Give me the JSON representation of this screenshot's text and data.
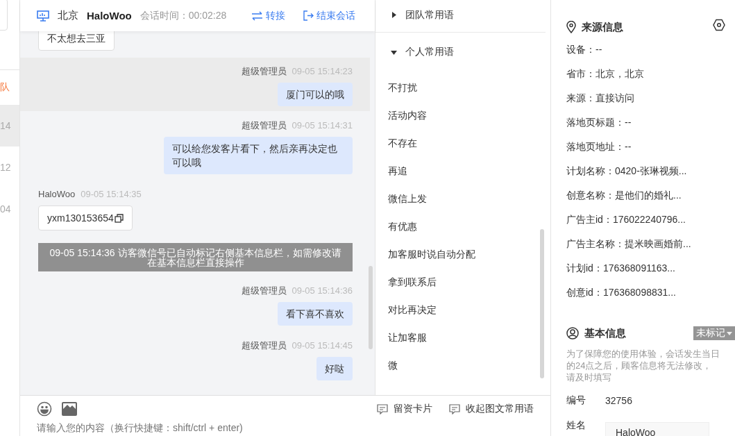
{
  "sidebar": {
    "items": [
      {
        "label": "队",
        "kind": "team",
        "selected": false
      },
      {
        "label": "14",
        "kind": "time",
        "selected": true
      },
      {
        "label": "12",
        "kind": "time",
        "selected": false
      },
      {
        "label": "04",
        "kind": "time",
        "selected": false
      }
    ]
  },
  "header": {
    "location": "北京",
    "visitor": "HaloWoo",
    "duration": "会话时间：00:02:28",
    "actions": [
      {
        "label": "转接",
        "kind": "transfer"
      },
      {
        "label": "结束会话",
        "kind": "end"
      }
    ]
  },
  "messages": [
    {
      "kind": "visitor",
      "text": "不太想去三亚",
      "highlighted": false,
      "copyable": false
    },
    {
      "kind": "agent",
      "sender": "超级管理员",
      "time": "09-05 15:14:23",
      "text": "厦门可以的哦",
      "highlighted": true
    },
    {
      "kind": "agent",
      "sender": "超级管理员",
      "time": "09-05 15:14:31",
      "text": "可以给您发客片看下，然后亲再决定也可以哦",
      "highlighted": false
    },
    {
      "kind": "visitor",
      "sender": "HaloWoo",
      "time": "09-05 15:14:35",
      "text": "yxm130153654",
      "highlighted": false,
      "copyable": true
    },
    {
      "kind": "system",
      "text": "09-05 15:14:36 访客微信号已自动标记右侧基本信息栏，如需修改请在基本信息栏直接操作"
    },
    {
      "kind": "agent",
      "sender": "超级管理员",
      "time": "09-05 15:14:36",
      "text": "看下喜不喜欢",
      "highlighted": false
    },
    {
      "kind": "agent",
      "sender": "超级管理员",
      "time": "09-05 15:14:45",
      "text": "好哒",
      "highlighted": false
    }
  ],
  "composer": {
    "placeholder": "请输入您的内容（换行快捷键：shift/ctrl + enter)",
    "tools": [
      {
        "label": "留资卡片"
      },
      {
        "label": "收起图文常用语"
      }
    ]
  },
  "phrases": {
    "groups": [
      {
        "title": "团队常用语",
        "expanded": false
      },
      {
        "title": "个人常用语",
        "expanded": true,
        "items": [
          "不打扰",
          "活动内容",
          "不存在",
          "再追",
          "微信上发",
          "有优惠",
          "加客服时说自动分配",
          "拿到联系后",
          "对比再决定",
          "让加客服",
          "微"
        ]
      }
    ]
  },
  "source_info": {
    "title": "来源信息",
    "rows": [
      "设备：--",
      "省市：北京，北京",
      "来源：直接访问",
      "落地页标题：--",
      "落地页地址：--",
      "计划名称：0420-张琳视频...",
      "创意名称：是他们的婚礼...",
      "广告主id：176022240796...",
      "广告主名称：提米映画婚前...",
      "计划id：176368091163...",
      "创意id：176368098831..."
    ]
  },
  "basic_info": {
    "title": "基本信息",
    "tag": "未标记",
    "note": "为了保障您的使用体验，会话发生当日的24点之后，顾客信息将无法修改，请及时填写",
    "fields": [
      {
        "label": "编号",
        "value": "32756",
        "kind": "text"
      },
      {
        "label": "姓名",
        "value": "HaloWoo",
        "kind": "input"
      }
    ]
  }
}
